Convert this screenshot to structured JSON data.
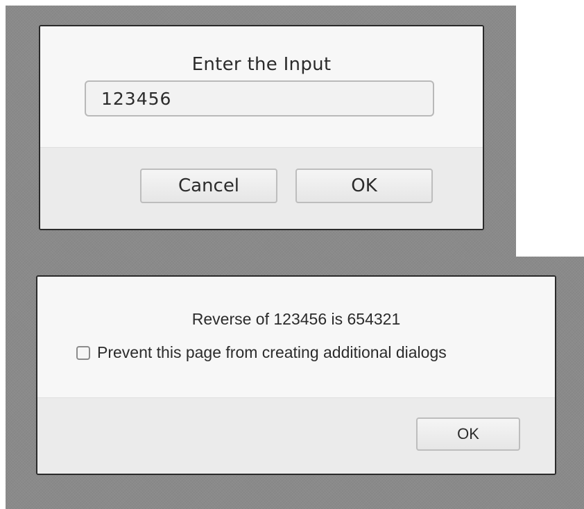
{
  "prompt_dialog": {
    "title": "Enter the Input",
    "input_value": "123456",
    "cancel_label": "Cancel",
    "ok_label": "OK"
  },
  "alert_dialog": {
    "message": "Reverse of 123456 is 654321",
    "checkbox_label": "Prevent this page from creating additional dialogs",
    "checkbox_checked": false,
    "ok_label": "OK"
  },
  "colors": {
    "overlay": "#8a8a8a",
    "dialog_body": "#f7f7f7",
    "dialog_footer": "#ebebeb",
    "dialog_border": "#2a2a2a"
  }
}
